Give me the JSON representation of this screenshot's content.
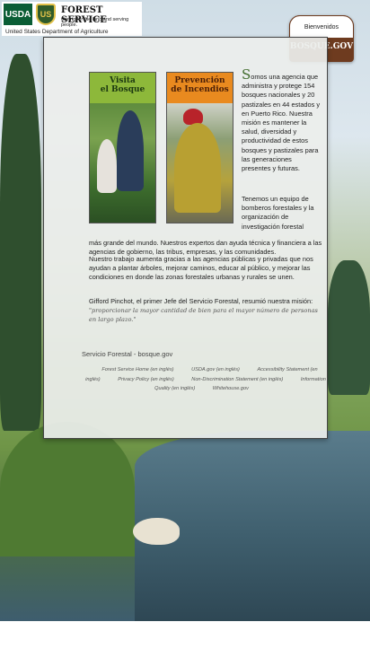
{
  "header": {
    "usda_label": "USDA",
    "shield_label": "US",
    "agency_name": "FOREST SERVICE",
    "agency_tagline": "Caring for the land and serving people.",
    "department": "United States Department of Agriculture"
  },
  "badge": {
    "welcome": "Bienvenidos",
    "site": "BOSQUE.GOV"
  },
  "promos": [
    {
      "title_line1": "Visita",
      "title_line2": "el Bosque"
    },
    {
      "title_line1": "Prevención",
      "title_line2": "de Incendios"
    }
  ],
  "content": {
    "intro_dropcap": "S",
    "intro_text": "omos una agencia que administra y protege 154 bosques nacionales y 20 pastizales en 44 estados y en Puerto Rico. Nuestra misión es mantener la salud, diversidad y productividad de estos bosques y pastizales para las generaciones presentes y futuras.",
    "firefighters_text_a": "Tenemos un equipo de bomberos forestales y la organización de investigación forestal",
    "firefighters_text_b": "más grande del mundo. Nuestros expertos dan ayuda técnica y financiera a las agencias de gobierno, las tribus, empresas, y las comunidades.",
    "partners_text": "Nuestro trabajo aumenta gracias a las agencias públicas y privadas que nos ayudan a plantar árboles, mejorar caminos, educar al público, y mejorar las condiciones en donde las zonas forestales urbanas y rurales se unen.",
    "pinchot_text": "Gifford Pinchot, el primer Jefe del Servicio Forestal, resumió nuestra misión:",
    "pinchot_quote": "\"proporcionar la mayor cantidad de bien para el mayor número de personas en largo plazo.\""
  },
  "footer": {
    "title": "Servicio Forestal - bosque.gov",
    "links": [
      "Forest Service Home (en inglés)",
      "USDA.gov (en inglés)",
      "Accessibility Statement (en inglés)",
      "Privacy Policy (en inglés)",
      "Non-Discrimination Statement (en inglés)",
      "Information Quality (en inglés)",
      "Whitehouse.gov"
    ]
  }
}
